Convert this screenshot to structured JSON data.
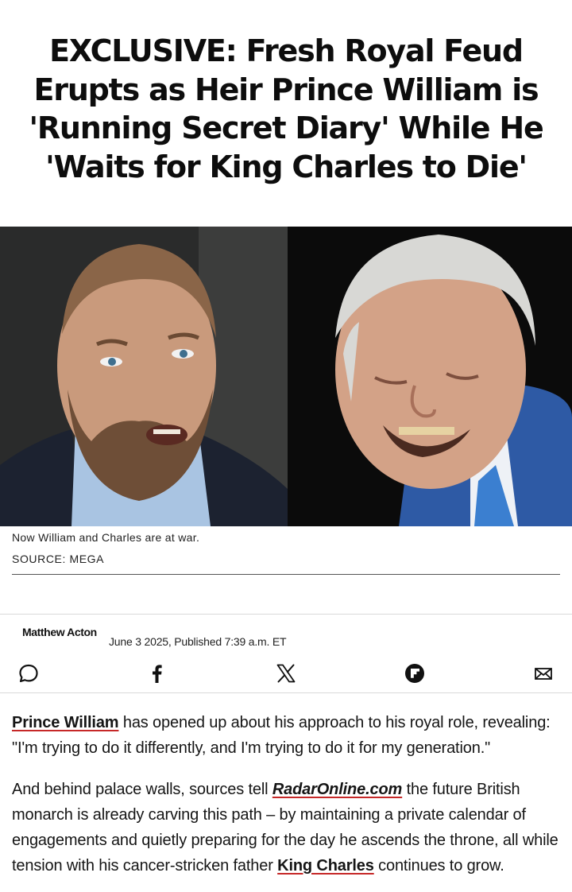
{
  "article": {
    "headline": "EXCLUSIVE: Fresh Royal Feud Erupts as Heir Prince William is 'Running Secret Diary' While He 'Waits for King Charles to Die'",
    "image": {
      "caption": "Now William and Charles are at war.",
      "source": "SOURCE: MEGA"
    },
    "byline": {
      "author": "Matthew Acton",
      "date": "June 3 2025, Published 7:39 a.m. ET"
    },
    "share_icons": [
      "comment-icon",
      "facebook-icon",
      "x-icon",
      "flipboard-icon",
      "email-icon"
    ],
    "paragraph1": {
      "link_text": "Prince William",
      "text": " has opened up about his approach to his royal role, revealing: \"I'm trying to do it differently, and I'm trying to do it for my generation.\""
    },
    "paragraph2": {
      "text_start": "And behind palace walls, sources tell ",
      "link_radar": "RadarOnline.com",
      "text_middle": " the future British monarch is already carving this path – by maintaining a private calendar of engagements and quietly preparing for the day he ascends the throne, all while tension with his cancer-stricken father ",
      "link_king": "King Charles",
      "text_end": " continues to grow."
    }
  },
  "colors": {
    "link_underline": "#c62828",
    "text": "#151515",
    "divider": "#d9d9d9"
  }
}
